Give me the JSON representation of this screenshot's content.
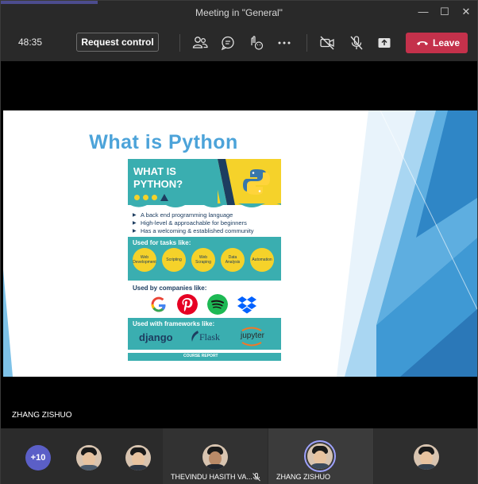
{
  "window": {
    "title": "Meeting in \"General\"",
    "controls": [
      "minimize-icon",
      "maximize-icon",
      "close-icon"
    ]
  },
  "toolbar": {
    "timer": "48:35",
    "request_control_label": "Request control",
    "icons": [
      "participants-icon",
      "chat-icon",
      "reactions-icon",
      "more-icon",
      "camera-off-icon",
      "mic-muted-icon",
      "share-icon"
    ],
    "leave_label": "Leave",
    "leave_color": "#c4314b"
  },
  "slide": {
    "title": "What is Python",
    "infographic": {
      "heading": "WHAT IS PYTHON?",
      "bullets": [
        "A back end programming language",
        "High-level & approachable for beginners",
        "Has a welcoming & established community"
      ],
      "tasks_label": "Used for tasks like:",
      "tasks": [
        "Web Development",
        "Scripting",
        "Web Scraping",
        "Data Analysis",
        "Automation"
      ],
      "companies_label": "Used by companies like:",
      "companies": [
        "google-logo",
        "pinterest-logo",
        "spotify-logo",
        "dropbox-logo"
      ],
      "frameworks_label": "Used with frameworks like:",
      "frameworks": [
        "django",
        "Flask",
        "jupyter"
      ],
      "footer": "COURSE REPORT"
    },
    "accent_color": "#4ca3d9"
  },
  "stage": {
    "presenter_name": "ZHANG ZISHUO"
  },
  "participants": {
    "more_count": "+10",
    "tiles": [
      {
        "name": ""
      },
      {
        "name": ""
      },
      {
        "name": "THEVINDU HASITH VA..."
      },
      {
        "name": "ZHANG ZISHUO"
      },
      {
        "name": ""
      }
    ]
  }
}
